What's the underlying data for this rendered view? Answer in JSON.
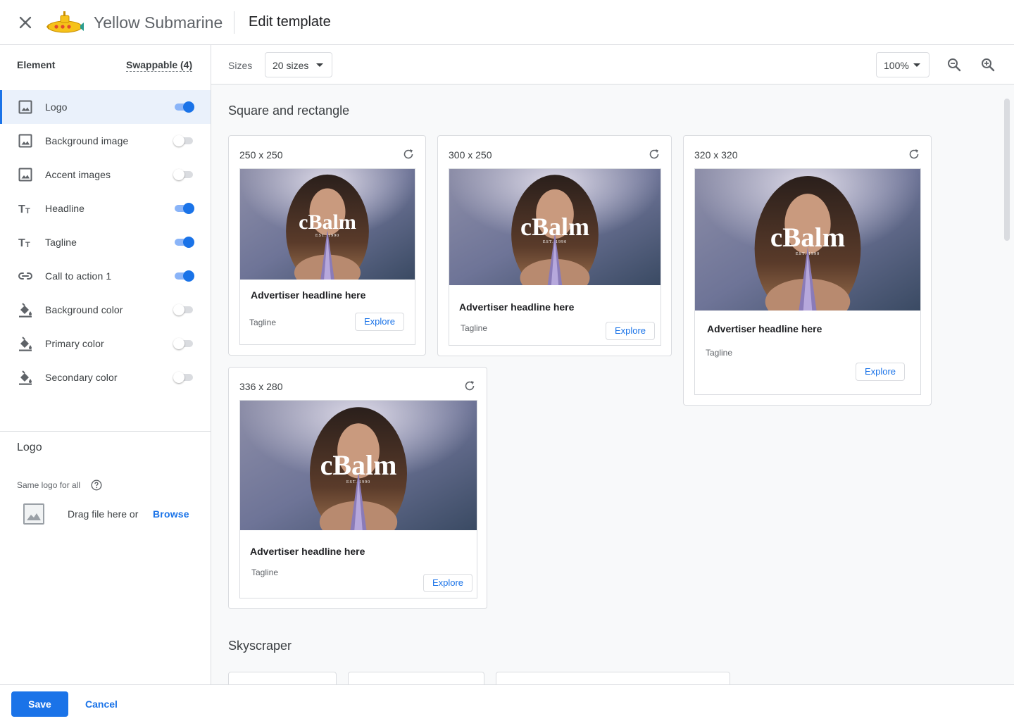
{
  "header": {
    "close_icon": "close-icon",
    "advertiser_name": "Yellow Submarine",
    "title": "Edit template"
  },
  "sidebar": {
    "tabs": {
      "element": "Element",
      "swappable": "Swappable (4)"
    },
    "elements": [
      {
        "label": "Logo",
        "icon": "image-icon",
        "enabled": true,
        "selected": true
      },
      {
        "label": "Background image",
        "icon": "image-icon",
        "enabled": false
      },
      {
        "label": "Accent images",
        "icon": "image-icon",
        "enabled": false
      },
      {
        "label": "Headline",
        "icon": "text-icon",
        "enabled": true
      },
      {
        "label": "Tagline",
        "icon": "text-icon",
        "enabled": true
      },
      {
        "label": "Call to action 1",
        "icon": "link-icon",
        "enabled": true
      },
      {
        "label": "Background color",
        "icon": "paint-bucket-icon",
        "enabled": false
      },
      {
        "label": "Primary color",
        "icon": "paint-bucket-icon",
        "enabled": false
      },
      {
        "label": "Secondary color",
        "icon": "paint-bucket-icon",
        "enabled": false
      }
    ],
    "detail": {
      "title": "Logo",
      "same_logo_label": "Same logo for all",
      "drag_text": "Drag file here or",
      "browse_label": "Browse"
    }
  },
  "toolbar": {
    "sizes_label": "Sizes",
    "sizes_value": "20 sizes",
    "zoom_value": "100%",
    "zoom_out_icon": "zoom-out-icon",
    "zoom_in_icon": "zoom-in-icon"
  },
  "canvas": {
    "sections": [
      {
        "title": "Square and rectangle"
      },
      {
        "title": "Skyscraper"
      }
    ],
    "ads": [
      {
        "size": "250 x 250",
        "headline": "Advertiser headline here",
        "tagline": "Tagline",
        "cta": "Explore",
        "logo_text": "cBalm",
        "logo_sub": "EST. 1990"
      },
      {
        "size": "300 x 250",
        "headline": "Advertiser headline here",
        "tagline": "Tagline",
        "cta": "Explore",
        "logo_text": "cBalm",
        "logo_sub": "EST. 1990"
      },
      {
        "size": "320 x 320",
        "headline": "Advertiser headline here",
        "tagline": "Tagline",
        "cta": "Explore",
        "logo_text": "cBalm",
        "logo_sub": "EST. 1990"
      },
      {
        "size": "336 x 280",
        "headline": "Advertiser headline here",
        "tagline": "Tagline",
        "cta": "Explore",
        "logo_text": "cBalm",
        "logo_sub": "EST. 1990"
      }
    ]
  },
  "footer": {
    "save_label": "Save",
    "cancel_label": "Cancel"
  },
  "colors": {
    "primary": "#1a73e8",
    "border": "#dadce0",
    "canvas_bg": "#f8f9fa"
  }
}
